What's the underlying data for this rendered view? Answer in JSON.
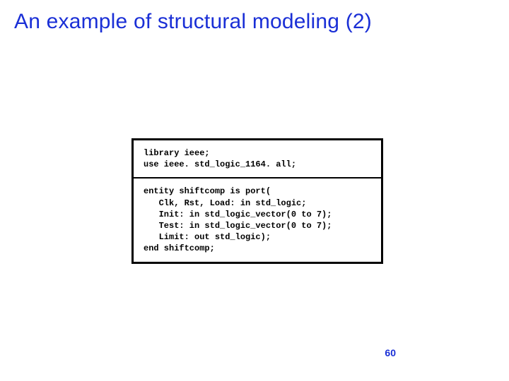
{
  "title": "An example of structural modeling (2)",
  "code": {
    "header": "library ieee;\nuse ieee. std_logic_1164. all;",
    "body": "entity shiftcomp is port(\n   Clk, Rst, Load: in std_logic;\n   Init: in std_logic_vector(0 to 7);\n   Test: in std_logic_vector(0 to 7);\n   Limit: out std_logic);\nend shiftcomp;"
  },
  "page_number": "60"
}
